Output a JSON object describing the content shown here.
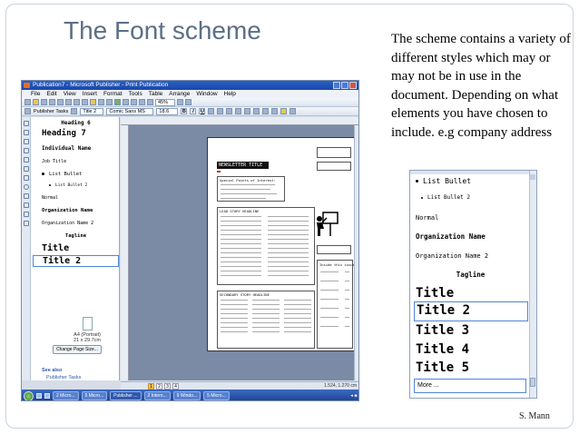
{
  "slide": {
    "title": "The Font scheme",
    "body": "The scheme contains a variety of different styles which may or may not be in use in the document. Depending on what elements you have chosen to include. e.g company address",
    "author": "S. Mann"
  },
  "app": {
    "window_title": "Publication7 - Microsoft Publisher - Print Publication",
    "menu": [
      "File",
      "Edit",
      "View",
      "Insert",
      "Format",
      "Tools",
      "Table",
      "Arrange",
      "Window",
      "Help"
    ],
    "zoom": "45%",
    "task_pane_label": "Publisher Tasks",
    "style_box": "Title 2",
    "font_box": "Comic Sans MS",
    "size_box": "18.6",
    "styles": [
      "Heading 6",
      "Heading 7",
      "Individual Name",
      "Job Title",
      "List Bullet",
      "List Bullet 2",
      "Normal",
      "Organization Name",
      "Organization Name 2",
      "Tagline",
      "Title",
      "Title 2"
    ],
    "paper_size": "A4 (Portrait)",
    "paper_dims": "21 x 29.7cm",
    "change_page_size": "Change Page Size...",
    "see_also": "See also",
    "publisher_tasks_link": "Publisher Tasks",
    "pages": [
      "1",
      "2",
      "3",
      "4"
    ],
    "coords": "1.524, 1.270 cm",
    "newsletter_title": "NEWSLETTER TITLE",
    "lead_story": "LEAD STORY HEADLINE",
    "secondary_story": "SECONDARY STORY HEADLINE",
    "special_points": "Special Points of Interest:",
    "inside_issue": "Inside this issue",
    "taskbar": [
      "2 Micro...",
      "5 Micro...",
      "Publisher ...",
      "2 Intern...",
      "9 Windo...",
      "5 Micro..."
    ]
  },
  "zoomed_styles": {
    "list_bullet": "List Bullet",
    "list_bullet_2": "List Bullet 2",
    "normal": "Normal",
    "org_name": "Organization Name",
    "org_name_2": "Organization Name 2",
    "tagline": "Tagline",
    "title": "Title",
    "title_2": "Title 2",
    "title_3": "Title 3",
    "title_4": "Title 4",
    "title_5": "Title 5",
    "more": "More ..."
  }
}
